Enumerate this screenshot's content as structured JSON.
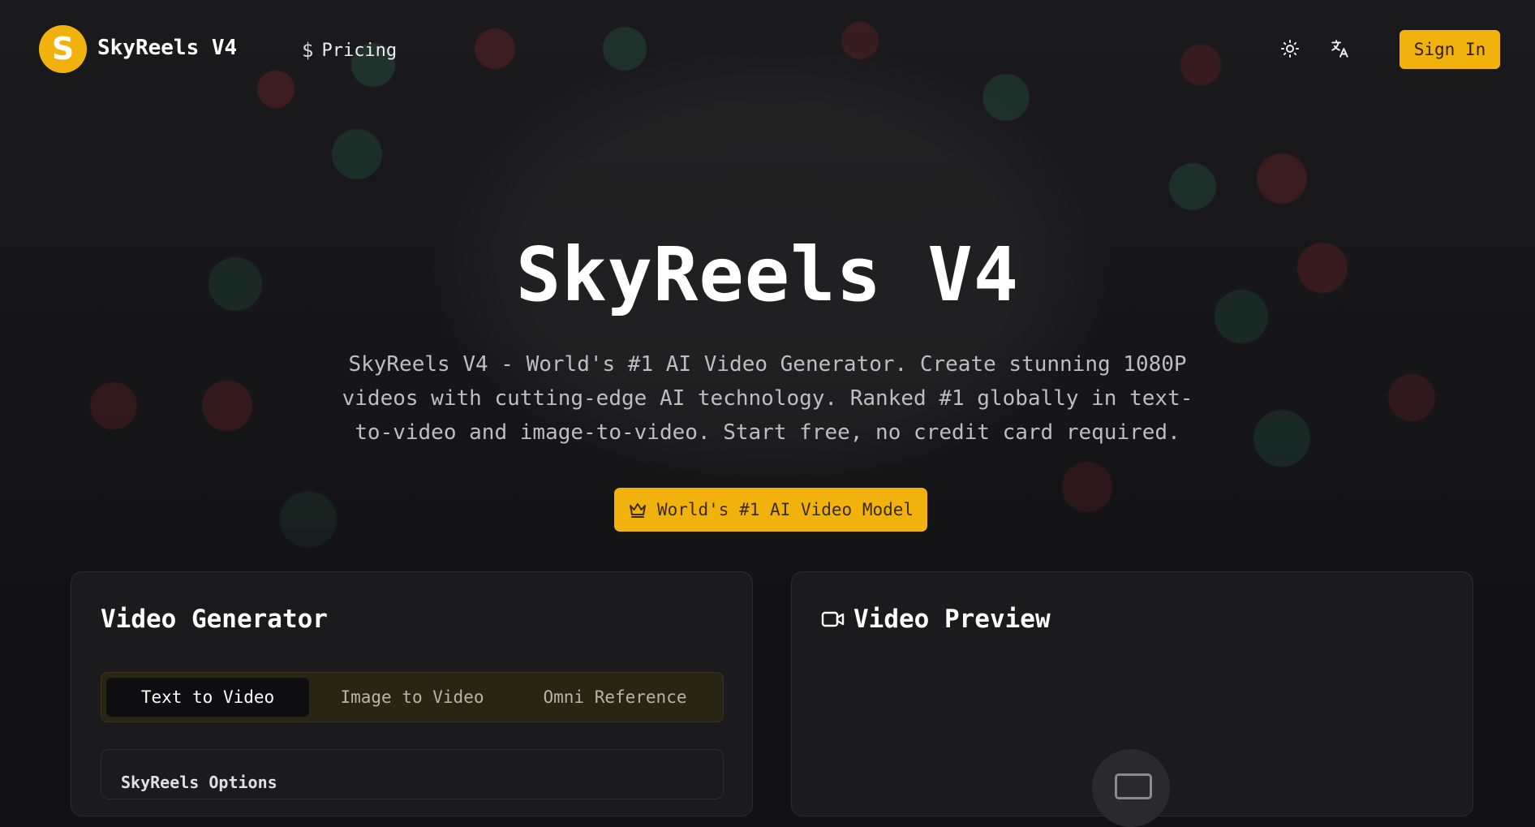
{
  "nav": {
    "logo_letter": "S",
    "brand": "SkyReels V4",
    "pricing_label": "Pricing",
    "theme_icon": "sun-icon",
    "language_icon": "translate-icon",
    "sign_in_label": "Sign In"
  },
  "hero": {
    "title": "SkyReels V4",
    "subtitle": "SkyReels V4 - World's #1 AI Video Generator. Create stunning 1080P videos with cutting-edge AI technology. Ranked #1 globally in text-to-video and image-to-video. Start free, no credit card required.",
    "badge_label": "World's #1 AI Video Model",
    "badge_icon": "crown-icon"
  },
  "generator": {
    "title": "Video Generator",
    "tabs": [
      {
        "label": "Text to Video",
        "active": true
      },
      {
        "label": "Image to Video",
        "active": false
      },
      {
        "label": "Omni Reference",
        "active": false
      }
    ],
    "options_label": "SkyReels Options"
  },
  "preview": {
    "title": "Video Preview",
    "icon": "video-camera-icon"
  },
  "colors": {
    "accent": "#f2b20d",
    "background": "#121214",
    "card": "#1b1b1e"
  }
}
